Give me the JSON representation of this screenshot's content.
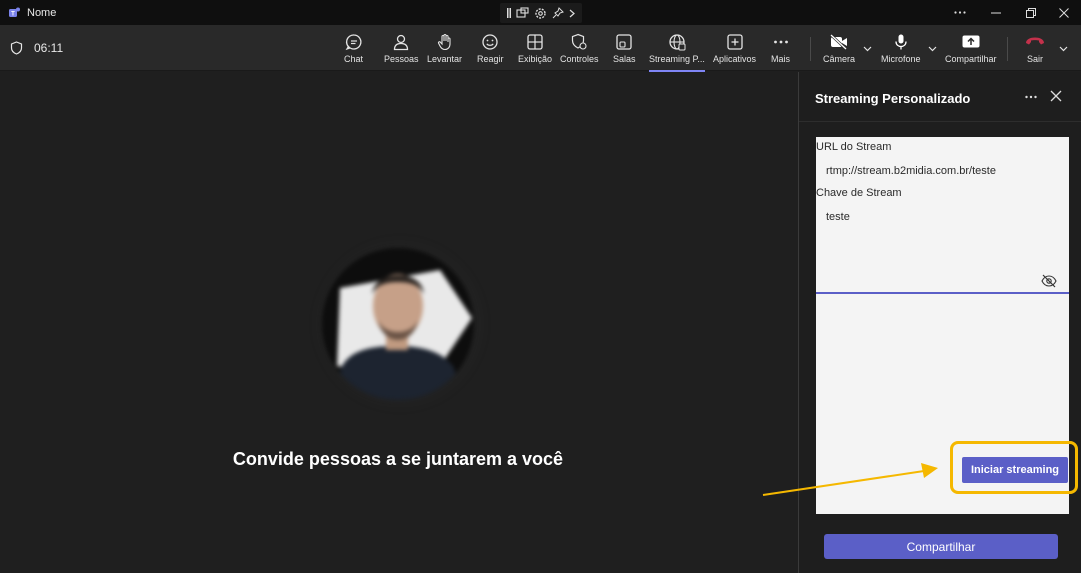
{
  "titlebar": {
    "app_title": "Nome"
  },
  "toolbar": {
    "timer": "06:11",
    "buttons": {
      "chat": "Chat",
      "people": "Pessoas",
      "raise": "Levantar",
      "react": "Reagir",
      "view": "Exibição",
      "controls": "Controles",
      "rooms": "Salas",
      "streaming": "Streaming P...",
      "apps": "Aplicativos",
      "more": "Mais",
      "camera": "Câmera",
      "mic": "Microfone",
      "share": "Compartilhar",
      "leave": "Sair"
    }
  },
  "stage": {
    "invite_text": "Convide pessoas a se juntarem a você"
  },
  "panel": {
    "title": "Streaming Personalizado",
    "stream_url_label": "URL do Stream",
    "stream_url_value": "rtmp://stream.b2midia.com.br/teste",
    "stream_key_label": "Chave de Stream",
    "stream_key_value": "teste",
    "start_button": "Iniciar streaming",
    "share_button": "Compartilhar"
  },
  "colors": {
    "accent": "#5b5fc7",
    "highlight": "#f5b800",
    "leave_red": "#c4314b"
  }
}
